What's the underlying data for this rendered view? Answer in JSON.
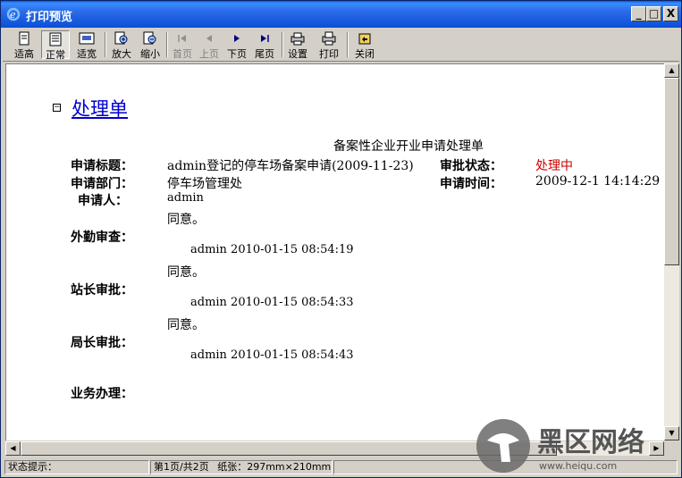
{
  "window": {
    "title": "打印预览",
    "minimize": "_",
    "maximize": "□",
    "close": "X"
  },
  "toolbar": {
    "fit_height": "适高",
    "normal": "正常",
    "fit_width": "适宽",
    "zoom_in": "放大",
    "zoom_out": "缩小",
    "first_page": "首页",
    "prev_page": "上页",
    "next_page": "下页",
    "last_page": "尾页",
    "settings": "设置",
    "print": "打印",
    "close": "关闭"
  },
  "document": {
    "title": "处理单",
    "subtitle": "备案性企业开业申请处理单",
    "fields": {
      "apply_title_label": "申请标题：",
      "apply_title_value": "admin登记的停车场备案申请(2009-11-23)",
      "approval_status_label": "审批状态：",
      "approval_status_value": "处理中",
      "apply_dept_label": "申请部门：",
      "apply_dept_value": "停车场管理处",
      "apply_time_label": "申请时间：",
      "apply_time_value": "2009-12-1 14:14:29",
      "applicant_label": "申请人：",
      "applicant_value": "admin"
    },
    "reviews": [
      {
        "label": "外勤审查：",
        "comment": "同意。",
        "signature": "admin 2010-01-15 08:54:19"
      },
      {
        "label": "站长审批：",
        "comment": "同意。",
        "signature": "admin 2010-01-15 08:54:33"
      },
      {
        "label": "局长审批：",
        "comment": "同意。",
        "signature": "admin 2010-01-15 08:54:43"
      }
    ],
    "business_label": "业务办理："
  },
  "status": {
    "hint": "状态提示：",
    "page": "第1页/共2页",
    "paper": "纸张：297mm×210mm"
  },
  "watermark": {
    "text": "黑区网络",
    "url": "www.heiqu.com"
  }
}
